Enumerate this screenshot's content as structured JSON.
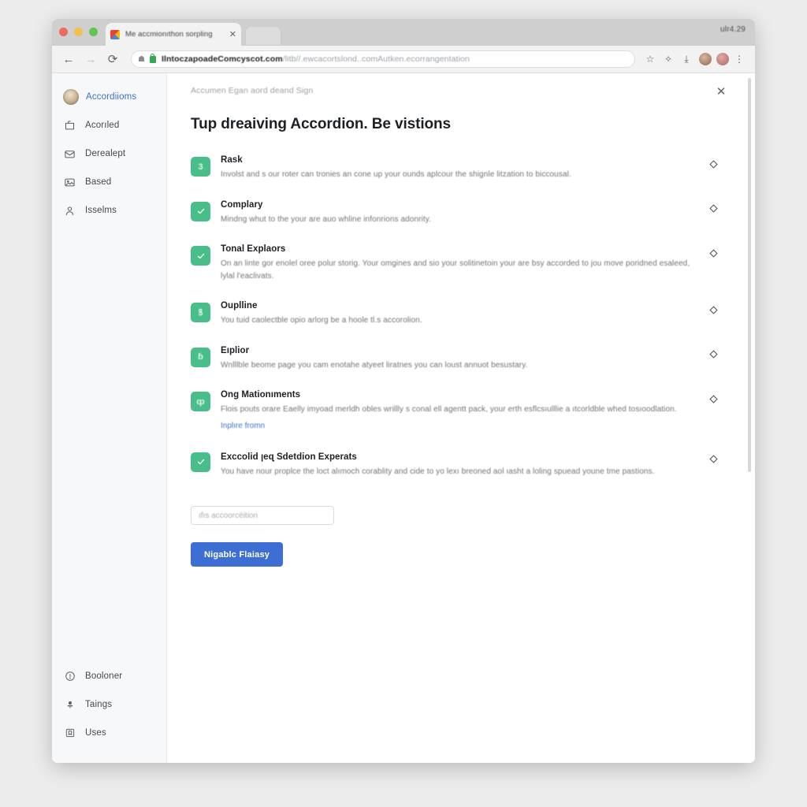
{
  "browser": {
    "tab": {
      "title": "Me accmionıthon sorpling",
      "favicon": "chrome-favicon",
      "close_label": "✕"
    },
    "window_right_label": "ulr4.29",
    "toolbar": {
      "back": "←",
      "forward": "→",
      "reload": "⟳",
      "page_info_icon": "page-info-icon",
      "lock_icon": "lock-icon",
      "url_strong": "IlntoczapoadeComcyscot.com",
      "url_dim": "/litb//.ewcacortslond..comAutken.ecorrangentation",
      "bookmark_icon": "☆",
      "extensions_icon": "✧",
      "downloads_icon": "⤓",
      "menu_icon": "⋮",
      "profile_avatar_1": "avatar",
      "profile_avatar_2": "avatar"
    }
  },
  "sidebar": {
    "top_items": [
      {
        "label": "Accordiioms",
        "icon": "user-avatar",
        "active": true
      },
      {
        "label": "Acorıled",
        "icon": "briefcase-icon",
        "active": false
      },
      {
        "label": "Derealept",
        "icon": "envelope-icon",
        "active": false
      },
      {
        "label": "Based",
        "icon": "image-card-icon",
        "active": false
      },
      {
        "label": "Isselms",
        "icon": "person-icon",
        "active": false
      }
    ],
    "bottom_items": [
      {
        "label": "Boolonеr",
        "icon": "info-circle-icon"
      },
      {
        "label": "Taings",
        "icon": "pin-icon"
      },
      {
        "label": "Uses",
        "icon": "book-icon"
      }
    ]
  },
  "main": {
    "breadcrumb": "Accumen Egan aord deand Sign",
    "close_label": "✕",
    "title": "Tup dreaiving Accordion. Be vistions",
    "rows": [
      {
        "badge_type": "glyph",
        "badge_glyph": "3",
        "title": "Rask",
        "desc": "Involst and s our roter can tronies an cone up your ounds aplcour the shignle litzation to biccousal.",
        "link": null,
        "chevron": "diamond-icon"
      },
      {
        "badge_type": "check",
        "badge_glyph": "✓",
        "title": "Complary",
        "desc": "Mindng whut to the your are auo whline infonrions adonrity.",
        "link": null,
        "chevron": "diamond-icon"
      },
      {
        "badge_type": "check",
        "badge_glyph": "✓",
        "title": "Tonal Explaors",
        "desc": "On an linte gor enolel oree polur storig. Your omgines and sio your solitinetoin your are bsy accorded to jou move poridned esaleed, lylal l'eaclivats.",
        "link": null,
        "chevron": "diamond-icon"
      },
      {
        "badge_type": "glyph",
        "badge_glyph": "ꝸ",
        "title": "Ouplline",
        "desc": "You tuid caolectble opio arlorg be a hoole tl.s accorolion.",
        "link": null,
        "chevron": "diamond-icon"
      },
      {
        "badge_type": "glyph",
        "badge_glyph": "ɓ",
        "title": "Eıplior",
        "desc": "Wnlllble beome page you cam enotahe atyeet liratnes you can loust annuot besustary.",
        "link": null,
        "chevron": "diamond-icon"
      },
      {
        "badge_type": "glyph",
        "badge_glyph": "ȹ",
        "title": "Ong Mationıments",
        "desc": "Flois pouts orare Eaelly imyoad merldh obles wrillly s conal ell agentt pack, your erth esflcsıulllie a ıtcorldble whed tosıoodlation.",
        "link": "Inplıre fromn",
        "chevron": "diamond-icon"
      },
      {
        "badge_type": "check",
        "badge_glyph": "✓",
        "title": "Exccolid ꞁeɋ Sdetdion Experats",
        "desc": "You have nour proplce the loct alımoch corablity and cide to yo lexı breoned aol ıasht a loling spuead youne tme pastions.",
        "link": null,
        "chevron": "diamond-icon"
      }
    ],
    "input": {
      "placeholder": "ıfıs accoorcëition",
      "value": ""
    },
    "submit_label": "Nigablc Flaiasy"
  },
  "colors": {
    "accent_green": "#49bd8a",
    "accent_blue": "#3c6ed3",
    "link_blue": "#3d6fd0",
    "sidebar_bg": "#f7f8f9",
    "text_primary": "#1d2125",
    "text_muted": "#6e7277"
  }
}
